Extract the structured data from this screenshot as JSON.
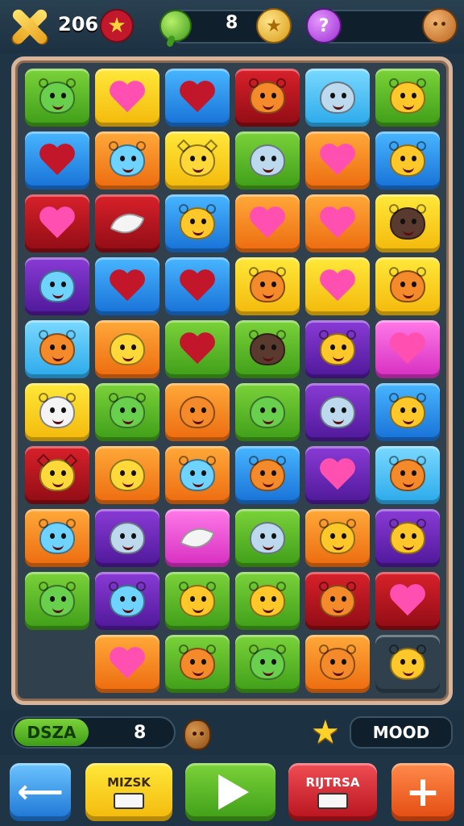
{
  "hud": {
    "score": "206",
    "mid_count": "8",
    "gold_coin_symbol": "★",
    "purple_badge_symbol": "?",
    "icons": [
      "close-x-icon",
      "star-badge-icon",
      "green-orb-icon",
      "gold-coin-icon",
      "purple-hint-icon",
      "bronze-coin-icon"
    ]
  },
  "board": {
    "columns": 6,
    "rows": 10,
    "tiles": [
      [
        {
          "color": "green",
          "piece": "dino"
        },
        {
          "color": "yellow",
          "piece": "heart"
        },
        {
          "color": "blue",
          "piece": "heart-red"
        },
        {
          "color": "red",
          "piece": "bear"
        },
        {
          "color": "cyan",
          "piece": "fish"
        },
        {
          "color": "green",
          "piece": "bee"
        }
      ],
      [
        {
          "color": "blue",
          "piece": "heart-red"
        },
        {
          "color": "orange",
          "piece": "mouse"
        },
        {
          "color": "yellow",
          "piece": "sun"
        },
        {
          "color": "green",
          "piece": "fish"
        },
        {
          "color": "orange",
          "piece": "heart"
        },
        {
          "color": "blue",
          "piece": "chick"
        }
      ],
      [
        {
          "color": "red",
          "piece": "heart"
        },
        {
          "color": "red",
          "piece": "feather"
        },
        {
          "color": "blue",
          "piece": "chick"
        },
        {
          "color": "orange",
          "piece": "heart"
        },
        {
          "color": "orange",
          "piece": "heart"
        },
        {
          "color": "yellow",
          "piece": "bat"
        }
      ],
      [
        {
          "color": "purple",
          "piece": "ghost"
        },
        {
          "color": "blue",
          "piece": "heart-red"
        },
        {
          "color": "blue",
          "piece": "heart-red"
        },
        {
          "color": "yellow",
          "piece": "bear"
        },
        {
          "color": "yellow",
          "piece": "heart"
        },
        {
          "color": "yellow",
          "piece": "bear"
        }
      ],
      [
        {
          "color": "cyan",
          "piece": "bird"
        },
        {
          "color": "orange",
          "piece": "lemon"
        },
        {
          "color": "green",
          "piece": "heart-red"
        },
        {
          "color": "green",
          "piece": "boar"
        },
        {
          "color": "purple",
          "piece": "chick"
        },
        {
          "color": "pink",
          "piece": "heart"
        }
      ],
      [
        {
          "color": "yellow",
          "piece": "lamb"
        },
        {
          "color": "green",
          "piece": "frog"
        },
        {
          "color": "orange",
          "piece": "orange"
        },
        {
          "color": "green",
          "piece": "blob"
        },
        {
          "color": "purple",
          "piece": "fish"
        },
        {
          "color": "blue",
          "piece": "chick"
        }
      ],
      [
        {
          "color": "red",
          "piece": "sun"
        },
        {
          "color": "orange",
          "piece": "lemon"
        },
        {
          "color": "orange",
          "piece": "mouse"
        },
        {
          "color": "blue",
          "piece": "bird"
        },
        {
          "color": "purple",
          "piece": "heart"
        },
        {
          "color": "cyan",
          "piece": "bird"
        }
      ],
      [
        {
          "color": "orange",
          "piece": "mouse"
        },
        {
          "color": "purple",
          "piece": "fish"
        },
        {
          "color": "pink",
          "piece": "feather"
        },
        {
          "color": "green",
          "piece": "fish"
        },
        {
          "color": "orange",
          "piece": "chick"
        },
        {
          "color": "purple",
          "piece": "chick"
        }
      ],
      [
        {
          "color": "green",
          "piece": "dino"
        },
        {
          "color": "purple",
          "piece": "mouse"
        },
        {
          "color": "green",
          "piece": "bee"
        },
        {
          "color": "green",
          "piece": "chick"
        },
        {
          "color": "red",
          "piece": "bear"
        },
        {
          "color": "red",
          "piece": "heart"
        }
      ],
      [
        null,
        {
          "color": "orange",
          "piece": "heart"
        },
        {
          "color": "green",
          "piece": "bird"
        },
        {
          "color": "green",
          "piece": "dino"
        },
        {
          "color": "orange",
          "piece": "bear"
        },
        {
          "color": "none",
          "piece": "chick"
        }
      ]
    ]
  },
  "status": {
    "left_label": "DSZA",
    "left_count": "8",
    "right_label": "MOOD"
  },
  "buttons": {
    "back": "⟵",
    "mizsk": "MIZSK",
    "play": "",
    "rijtrsa": "RIJTRSA",
    "plus": "+"
  },
  "colors": {
    "green": "#5bb82a",
    "yellow": "#f7cd1f",
    "blue": "#2b8ff0",
    "red": "#b4141f",
    "cyan": "#4cc0f4",
    "orange": "#f5821f",
    "purple": "#6a27b8",
    "pink": "#ee4fd6"
  }
}
